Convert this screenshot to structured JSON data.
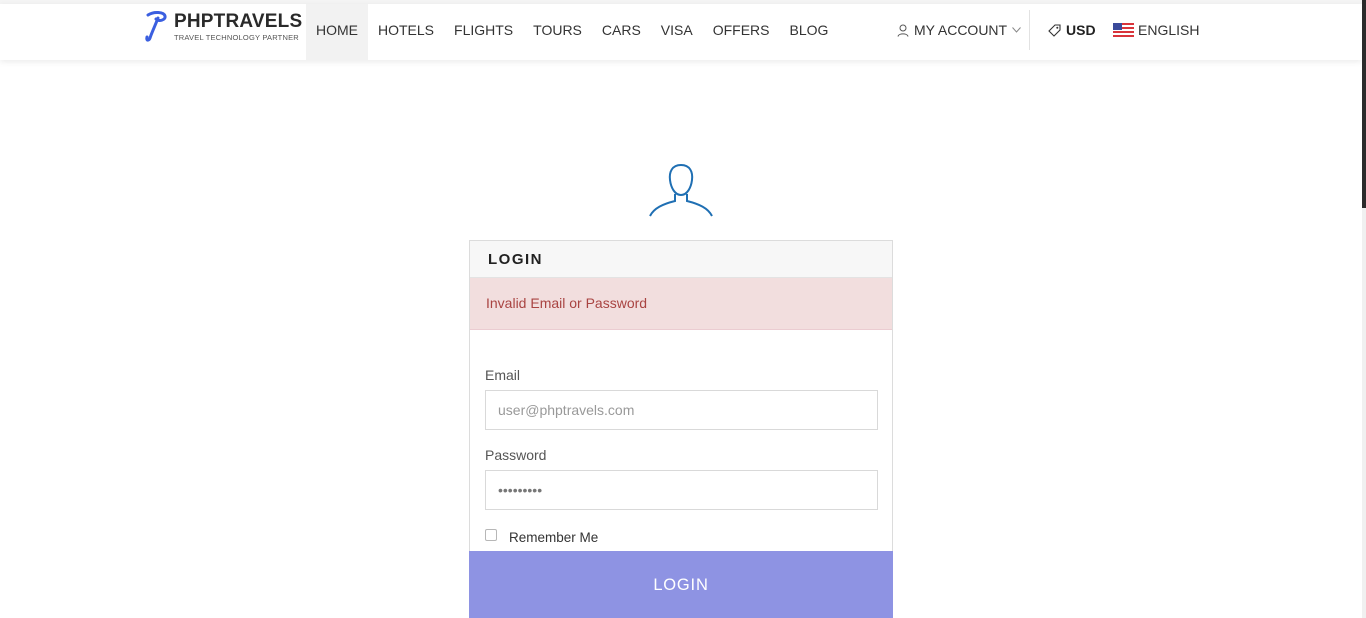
{
  "header": {
    "logo": {
      "brand": "PHPTRAVELS",
      "tagline": "TRAVEL TECHNOLOGY PARTNER"
    },
    "nav": [
      {
        "label": "HOME",
        "active": true
      },
      {
        "label": "HOTELS"
      },
      {
        "label": "FLIGHTS"
      },
      {
        "label": "TOURS"
      },
      {
        "label": "CARS"
      },
      {
        "label": "VISA"
      },
      {
        "label": "OFFERS"
      },
      {
        "label": "BLOG"
      }
    ],
    "account_label": "MY ACCOUNT",
    "currency": "USD",
    "language": "ENGLISH"
  },
  "login": {
    "title": "LOGIN",
    "error": "Invalid Email or Password",
    "email_label": "Email",
    "email_placeholder": "user@phptravels.com",
    "password_label": "Password",
    "password_value": "*********",
    "remember_label": "Remember Me",
    "submit_label": "LOGIN"
  },
  "colors": {
    "accent": "#8e93e3",
    "alert_bg": "#f2dede",
    "alert_text": "#a94442",
    "logo_blue": "#3b5fe0",
    "icon_blue": "#1f6fb3"
  },
  "icons": [
    "phptravels-logo-icon",
    "user-icon",
    "chevron-down-icon",
    "tag-icon",
    "us-flag-icon",
    "user-avatar-icon"
  ]
}
